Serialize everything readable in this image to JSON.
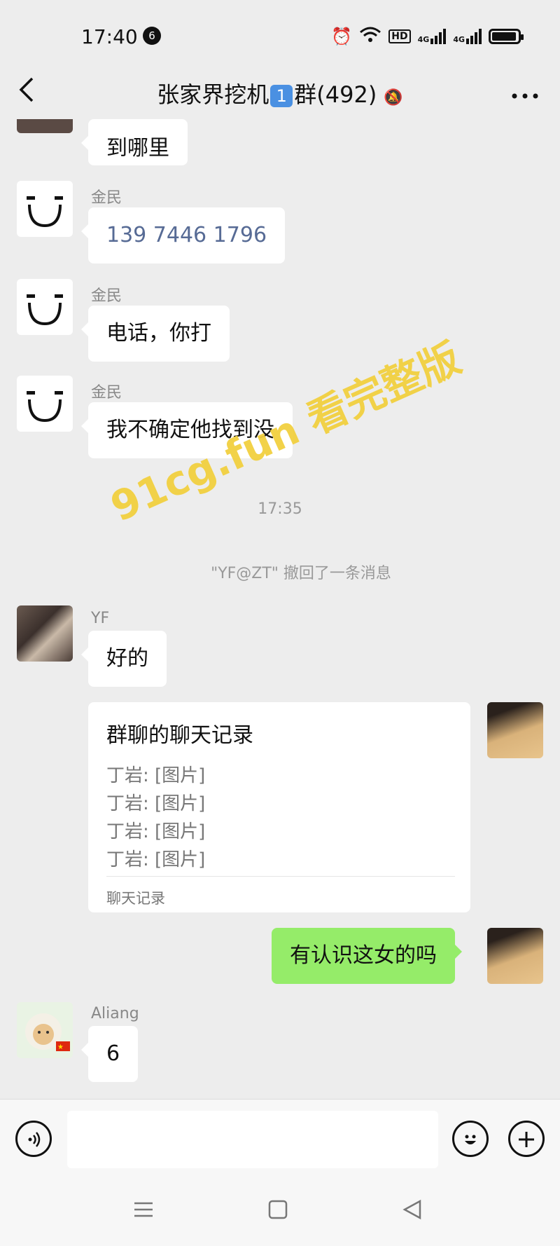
{
  "status": {
    "time": "17:40",
    "badge": "6",
    "icons": [
      "alarm-icon",
      "wifi-icon",
      "hd-icon",
      "signal-4g-icon",
      "signal-4g-icon",
      "battery-icon"
    ],
    "hd": "HD",
    "net": "4G"
  },
  "header": {
    "title_pre": "张家界挖机",
    "title_num": "1",
    "title_post": "群(492)"
  },
  "messages": {
    "m0": {
      "text": "到哪里"
    },
    "m1": {
      "sender": "金民",
      "text": "139 7446 1796"
    },
    "m2": {
      "sender": "金民",
      "text": "电话，你打"
    },
    "m3": {
      "sender": "金民",
      "text": "我不确定他找到没"
    },
    "time_divider": "17:35",
    "recall": "\"YF@ZT\" 撤回了一条消息",
    "m4": {
      "sender": "YF",
      "text": "好的"
    },
    "card": {
      "title": "群聊的聊天记录",
      "lines": [
        "丁岩: [图片]",
        "丁岩: [图片]",
        "丁岩: [图片]",
        "丁岩: [图片]"
      ],
      "footer": "聊天记录"
    },
    "m5": {
      "text": "有认识这女的吗"
    },
    "m6": {
      "sender": "Aliang",
      "text": "6"
    }
  },
  "watermark": "91cg.fun 看完整版",
  "colors": {
    "bubble_green": "#95ec69",
    "phone_link": "#576b95",
    "background": "#ededed"
  }
}
